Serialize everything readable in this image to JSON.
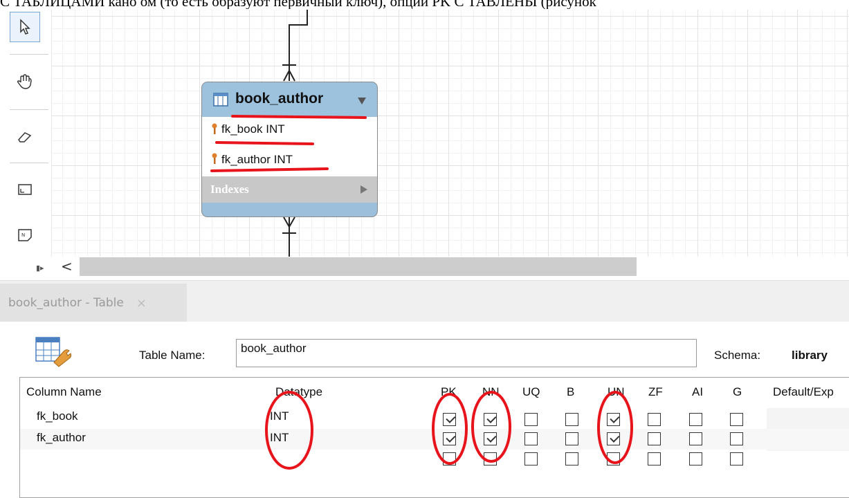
{
  "doc_text_line": "С ТАБЛИЦАМИ кано ом (то есть образуют первичный ключ), опции PK С ТАВЛЕНЫ (рисунок",
  "tools": [
    {
      "name": "pointer-icon"
    },
    {
      "name": "hand-icon"
    },
    {
      "name": "eraser-icon"
    },
    {
      "name": "layer-icon"
    },
    {
      "name": "note-icon"
    }
  ],
  "erd": {
    "title": "book_author",
    "columns": [
      "fk_book INT",
      "fk_author INT"
    ],
    "indexes_label": "Indexes"
  },
  "scroll_arrow": "<",
  "tab": {
    "label": "book_author - Table",
    "close": "×"
  },
  "editor": {
    "table_name_label": "Table Name:",
    "table_name_value": "book_author",
    "schema_label": "Schema:",
    "schema_value": "library"
  },
  "grid": {
    "headers": [
      "Column Name",
      "Datatype",
      "PK",
      "NN",
      "UQ",
      "B",
      "UN",
      "ZF",
      "AI",
      "G",
      "Default/Exp"
    ],
    "rows": [
      {
        "name": "fk_book",
        "type": "INT",
        "flags": [
          true,
          true,
          false,
          false,
          true,
          false,
          false,
          false
        ]
      },
      {
        "name": "fk_author",
        "type": "INT",
        "flags": [
          true,
          true,
          false,
          false,
          true,
          false,
          false,
          false
        ]
      },
      {
        "name": "",
        "type": "",
        "flags": [
          false,
          false,
          false,
          false,
          false,
          false,
          false,
          false
        ]
      }
    ]
  },
  "colors": {
    "annotation": "#e8141b",
    "erd_header": "#9dc2dd",
    "canvas_grid": "#e2e2e2"
  }
}
